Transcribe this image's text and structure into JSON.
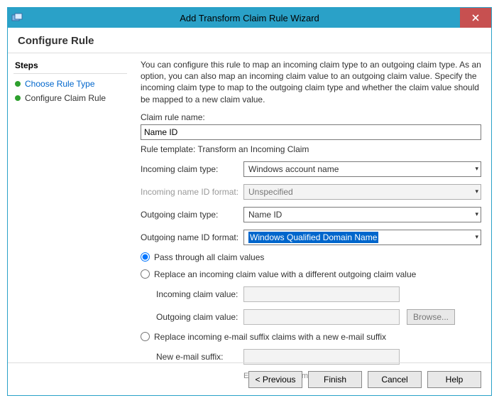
{
  "window": {
    "title": "Add Transform Claim Rule Wizard"
  },
  "subheader": "Configure Rule",
  "steps": {
    "header": "Steps",
    "items": [
      {
        "label": "Choose Rule Type",
        "active": false
      },
      {
        "label": "Configure Claim Rule",
        "active": true
      }
    ]
  },
  "main": {
    "description": "You can configure this rule to map an incoming claim type to an outgoing claim type. As an option, you can also map an incoming claim value to an outgoing claim value. Specify the incoming claim type to map to the outgoing claim type and whether the claim value should be mapped to a new claim value.",
    "claimRuleNameLabel": "Claim rule name:",
    "claimRuleName": "Name ID",
    "ruleTemplate": "Rule template: Transform an Incoming Claim",
    "fields": {
      "incomingClaimTypeLabel": "Incoming claim type:",
      "incomingClaimType": "Windows account name",
      "incomingNameIdFormatLabel": "Incoming name ID format:",
      "incomingNameIdFormat": "Unspecified",
      "outgoingClaimTypeLabel": "Outgoing claim type:",
      "outgoingClaimType": "Name ID",
      "outgoingNameIdFormatLabel": "Outgoing name ID format:",
      "outgoingNameIdFormat": "Windows Qualified Domain Name"
    },
    "radios": {
      "passAll": "Pass through all claim values",
      "replaceDiff": "Replace an incoming claim value with a different outgoing claim value",
      "replaceSuffix": "Replace incoming e-mail suffix claims with a new e-mail suffix"
    },
    "subfields": {
      "incomingClaimValueLabel": "Incoming claim value:",
      "outgoingClaimValueLabel": "Outgoing claim value:",
      "browse": "Browse...",
      "newEmailSuffixLabel": "New e-mail suffix:",
      "example": "Example: fabrikam.com"
    }
  },
  "buttons": {
    "previous": "< Previous",
    "finish": "Finish",
    "cancel": "Cancel",
    "help": "Help"
  }
}
